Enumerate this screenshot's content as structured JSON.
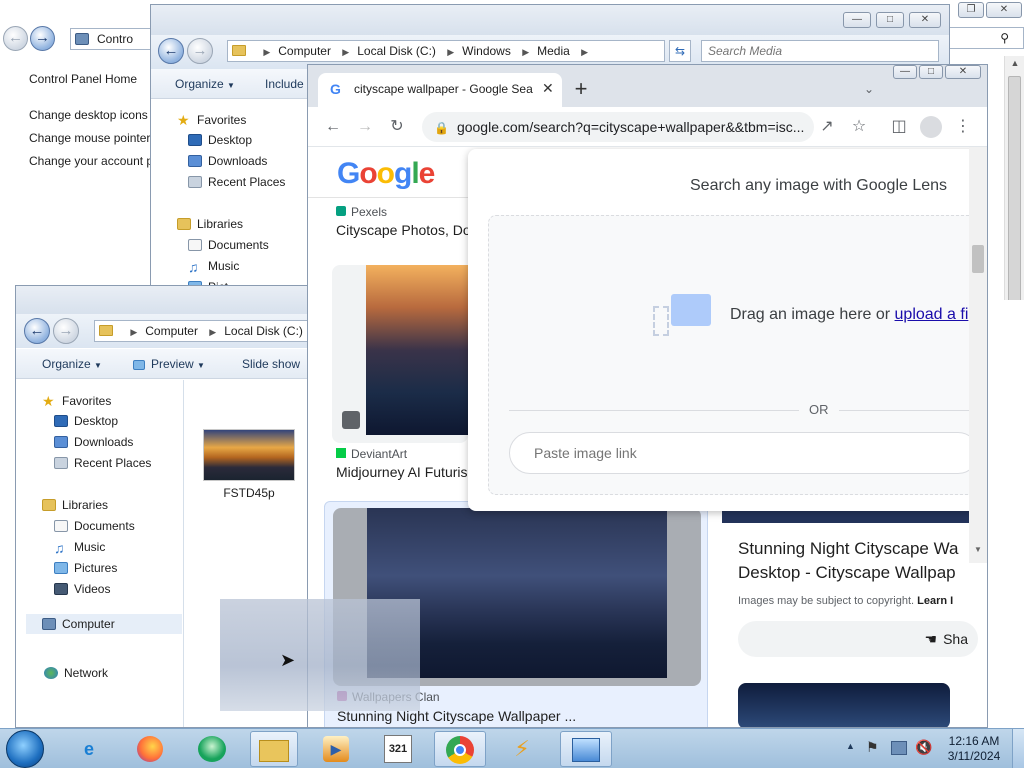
{
  "control_panel": {
    "address_segment": "Contro",
    "links": [
      "Control Panel Home",
      "Change desktop icons",
      "Change mouse pointer",
      "Change your account p"
    ]
  },
  "media_window": {
    "address": [
      "Computer",
      "Local Disk (C:)",
      "Windows",
      "Media"
    ],
    "search_placeholder": "Search Media",
    "toolbar": {
      "organize": "Organize",
      "include": "Include"
    },
    "nav": {
      "favorites": "Favorites",
      "favorites_items": [
        "Desktop",
        "Downloads",
        "Recent Places"
      ],
      "libraries": "Libraries",
      "libraries_items": [
        "Documents",
        "Music",
        "Pict"
      ]
    }
  },
  "front_explorer": {
    "address": [
      "Computer",
      "Local Disk (C:)"
    ],
    "toolbar": {
      "organize": "Organize",
      "preview": "Preview",
      "slideshow": "Slide show"
    },
    "nav": {
      "favorites": "Favorites",
      "favorites_items": [
        "Desktop",
        "Downloads",
        "Recent Places"
      ],
      "libraries": "Libraries",
      "libraries_items": [
        "Documents",
        "Music",
        "Pictures",
        "Videos"
      ],
      "computer": "Computer",
      "network": "Network"
    },
    "file": {
      "name": "FSTD45p"
    }
  },
  "chrome": {
    "tab_title": "cityscape wallpaper - Google Sea",
    "url": "google.com/search?q=cityscape+wallpaper&&tbm=isc...",
    "results": [
      {
        "source": "Pexels",
        "title": "Cityscape Photos, Do"
      },
      {
        "source": "DeviantArt",
        "title": "Midjourney AI Futuris"
      },
      {
        "source": "Wallpapers Clan",
        "title": "Stunning Night Cityscape Wallpaper ..."
      }
    ],
    "lens": {
      "heading": "Search any image with Google Lens",
      "drag_text": "Drag an image here or ",
      "upload_link": "upload a fi",
      "or": "OR",
      "paste_placeholder": "Paste image link"
    },
    "side_panel": {
      "title_line1": "Stunning Night Cityscape Wa",
      "title_line2": "Desktop - Cityscape Wallpap",
      "copyright": "Images may be subject to copyright. ",
      "learn": "Learn I",
      "share": "Sha"
    }
  },
  "taskbar": {
    "time": "12:16 AM",
    "date": "3/11/2024",
    "calendar_badge": "321"
  }
}
